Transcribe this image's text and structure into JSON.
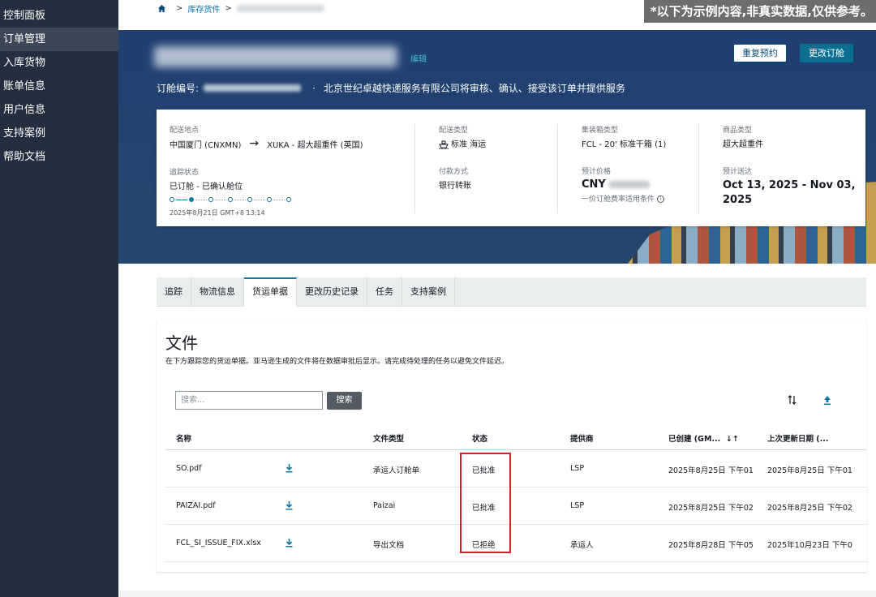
{
  "sidebar": {
    "items": [
      {
        "label": "控制面板"
      },
      {
        "label": "订单管理"
      },
      {
        "label": "入库货物"
      },
      {
        "label": "账单信息"
      },
      {
        "label": "用户信息"
      },
      {
        "label": "支持案例"
      },
      {
        "label": "帮助文档"
      }
    ],
    "active_index": 1
  },
  "breadcrumb": {
    "home_icon": "home-icon",
    "link": "库存货件"
  },
  "disclaimer": "*以下为示例内容,非真实数据,仅供参考。",
  "hero": {
    "edit_label": "编辑",
    "rebook_label": "重复预约",
    "change_label": "更改订舱",
    "booking_prefix": "订舱编号:",
    "provider_text": "北京世纪卓越快递服务有限公司将审核、确认、接受该订单并提供服务",
    "separator": "·"
  },
  "info": {
    "route_label": "配送地点",
    "route_from": "中国厦门 (CNXMN)",
    "route_to": "XUKA - 超大超重件 (英国)",
    "status_label": "追踪状态",
    "status_value": "已订舱 - 已确认舱位",
    "timestamp": "2025年8月21日 GMT+8 13:14",
    "ship_type_label": "配送类型",
    "ship_type_value": "标准 海运",
    "payment_label": "付款方式",
    "payment_value": "银行转账",
    "container_label": "集装箱类型",
    "container_value": "FCL - 20' 标准干箱 (1)",
    "price_label": "预计价格",
    "price_currency": "CNY",
    "price_note": "一价订舱费率适用条件",
    "goods_label": "商品类型",
    "goods_value": "超大超重件",
    "delivery_label": "预计送达",
    "delivery_value": "Oct 13, 2025 - Nov 03, 2025"
  },
  "tabs": [
    {
      "label": "追踪"
    },
    {
      "label": "物流信息"
    },
    {
      "label": "货运单据"
    },
    {
      "label": "更改历史记录"
    },
    {
      "label": "任务"
    },
    {
      "label": "支持案例"
    }
  ],
  "active_tab": 2,
  "documents": {
    "title": "文件",
    "description": "在下方跟踪您的货运单据。亚马逊生成的文件将在数据审批后显示。请完成待处理的任务以避免文件延迟。",
    "search_placeholder": "搜索...",
    "search_button": "搜索",
    "columns": {
      "name": "名称",
      "file_type": "文件类型",
      "status": "状态",
      "provider": "提供商",
      "created": "已创建 (GM...",
      "updated": "上次更新日期 (..."
    },
    "rows": [
      {
        "name": "SO.pdf",
        "file_type": "承运人订舱单",
        "status": "已批准",
        "provider": "LSP",
        "created": "2025年8月25日 下午01",
        "updated": "2025年8月25日 下午01"
      },
      {
        "name": "PAIZAI.pdf",
        "file_type": "Paizai",
        "status": "已批准",
        "provider": "LSP",
        "created": "2025年8月25日 下午02",
        "updated": "2025年8月25日 下午02"
      },
      {
        "name": "FCL_SI_ISSUE_FIX.xlsx",
        "file_type": "导出文档",
        "status": "已拒绝",
        "provider": "承运人",
        "created": "2025年8月28日 下午05",
        "updated": "2025年10月23日 下午0"
      }
    ]
  },
  "colors": {
    "sidebar_bg": "#232f3e",
    "accent": "#0d7a9e",
    "highlight": "#d8202a"
  }
}
